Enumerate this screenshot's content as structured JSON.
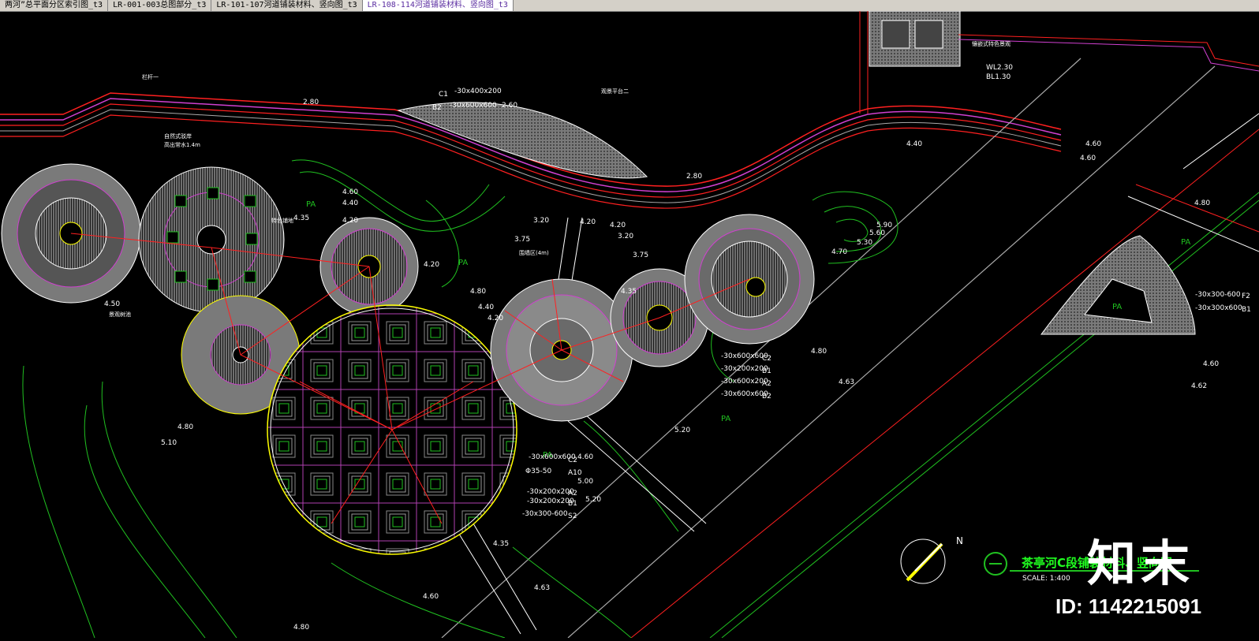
{
  "tabs": [
    {
      "label": "两河”总平面分区索引图_t3",
      "active": false
    },
    {
      "label": "LR-001-003总图部分_t3",
      "active": false
    },
    {
      "label": "LR-101-107河道铺装材料、竖向图_t3",
      "active": false
    },
    {
      "label": "LR-108-114河道铺装材料、竖向图_t3",
      "active": true
    }
  ],
  "drawing": {
    "title": "茶亭河C段铺装材料、竖向图",
    "scale": "SCALE: 1:400",
    "north_label": "N",
    "area_label": "PA",
    "levels": [
      "2.80",
      "2.60",
      "4.60",
      "4.40",
      "4.35",
      "4.20",
      "4.80",
      "4.50",
      "4.40",
      "4.20",
      "3.20",
      "3.75",
      "4.20",
      "4.20",
      "3.20",
      "3.75",
      "4.35",
      "4.20",
      "5.90",
      "5.60",
      "5.30",
      "4.70",
      "4.60",
      "4.80",
      "5.10",
      "4.60",
      "4.80",
      "5.20",
      "4.63",
      "4.35",
      "4.63",
      "5.00",
      "5.20",
      "4.80",
      "4.60",
      "4.62",
      "4.80",
      "2.80",
      "4.40",
      "4.60",
      "4.60"
    ],
    "material_callouts_top": [
      "-30x400x200",
      "-30x600x600"
    ],
    "material_codes_top": [
      "C1",
      "B2"
    ],
    "material_callouts_mid": [
      "-30x600x600",
      "-30x200x200",
      "-30x600x200",
      "-30x600x600"
    ],
    "material_codes_mid": [
      "C2",
      "B1",
      "A2",
      "B2"
    ],
    "material_callouts_low": [
      "-30x600x600",
      "Φ35-50",
      "-30x200x200",
      "-30x200x200",
      "-30x300-600"
    ],
    "material_codes_low": [
      "C2",
      "A10",
      "A2",
      "B1",
      "S2"
    ],
    "material_callouts_right": [
      "-30x300-600",
      "-30x300x600"
    ],
    "material_codes_right": [
      "F2",
      "B1"
    ],
    "wl": "WL2.30",
    "bl": "BL1.30",
    "notes": [
      "自然式驳岸",
      "高出常水1.4m",
      "围墙区(4m)",
      "栏杆一",
      "特色铺地",
      "观景平台二",
      "景观树池",
      "镶嵌式特色景观"
    ]
  },
  "watermark": {
    "brand": "知末",
    "id": "ID: 1142215091"
  },
  "colors": {
    "bg": "#000000",
    "red": "#ff2020",
    "magenta": "#d040d0",
    "green": "#20c020",
    "gray": "#8c8c8c",
    "white": "#ffffff",
    "yellow": "#ffff00"
  }
}
